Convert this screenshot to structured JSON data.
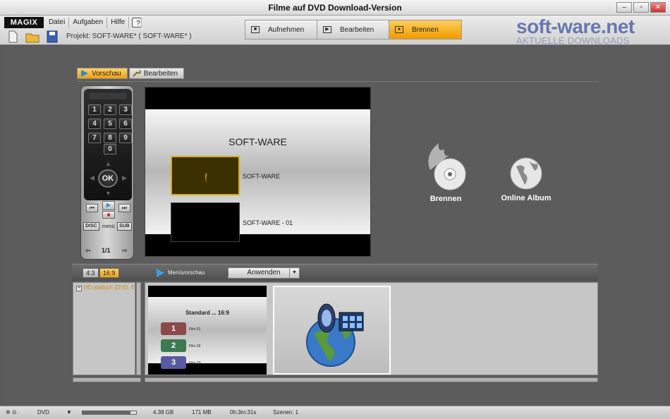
{
  "window": {
    "title": "Filme auf DVD Download-Version"
  },
  "brand": {
    "logo": "MAGIX"
  },
  "menu": {
    "items": [
      "Datei",
      "Aufgaben",
      "Hilfe"
    ]
  },
  "project": {
    "label": "Projekt: SOFT-WARE* ( SOFT-WARE* )"
  },
  "modes": [
    {
      "label": "Aufnehmen",
      "active": false
    },
    {
      "label": "Bearbeiten",
      "active": false
    },
    {
      "label": "Brennen",
      "active": true
    }
  ],
  "watermark": {
    "line1": "soft-ware.net",
    "line2": "AKTUELLE DOWNLOADS"
  },
  "subtabs": [
    {
      "label": "Vorschau",
      "active": true
    },
    {
      "label": "Bearbeiten",
      "active": false
    }
  ],
  "remote": {
    "keys": [
      "1",
      "2",
      "3",
      "4",
      "5",
      "6",
      "7",
      "8",
      "9"
    ],
    "zero": "0",
    "ok": "OK",
    "disc": "DISC",
    "menu": "menü",
    "sub": "SUB",
    "page": "1/1"
  },
  "preview": {
    "title": "SOFT-WARE",
    "items": [
      "SOFT-WARE",
      "SOFT-WARE - 01"
    ]
  },
  "targets": [
    {
      "label": "Brennen",
      "icon": "burn-disc-icon"
    },
    {
      "label": "Online Album",
      "icon": "globe-icon"
    }
  ],
  "lowerbar": {
    "ratios": [
      {
        "label": "4:3",
        "active": false
      },
      {
        "label": "16:9",
        "active": true
      }
    ],
    "menu_preview": "Menüvorschau",
    "apply": "Anwenden"
  },
  "tree": {
    "item": "HD statisch (DVD, B"
  },
  "templates": [
    {
      "title": "Standard ... 16:9",
      "buttons": [
        {
          "num": "1",
          "label": "Film 01",
          "color": "#8a4a4a"
        },
        {
          "num": "2",
          "label": "Film 02",
          "color": "#3d7a52"
        },
        {
          "num": "3",
          "label": "Film 03",
          "color": "#5a5aa0"
        }
      ]
    },
    {
      "title": "",
      "icon": "media-globe-icon"
    }
  ],
  "status": {
    "format": "DVD",
    "disc_fill": 0.9,
    "size": "4.38 GB",
    "used": "171 MB",
    "duration": "0h:3m:31s",
    "scenes": "Szenen: 1"
  },
  "colors": {
    "accent": "#f0a012",
    "active_tpl_border": "#d2ac28"
  }
}
